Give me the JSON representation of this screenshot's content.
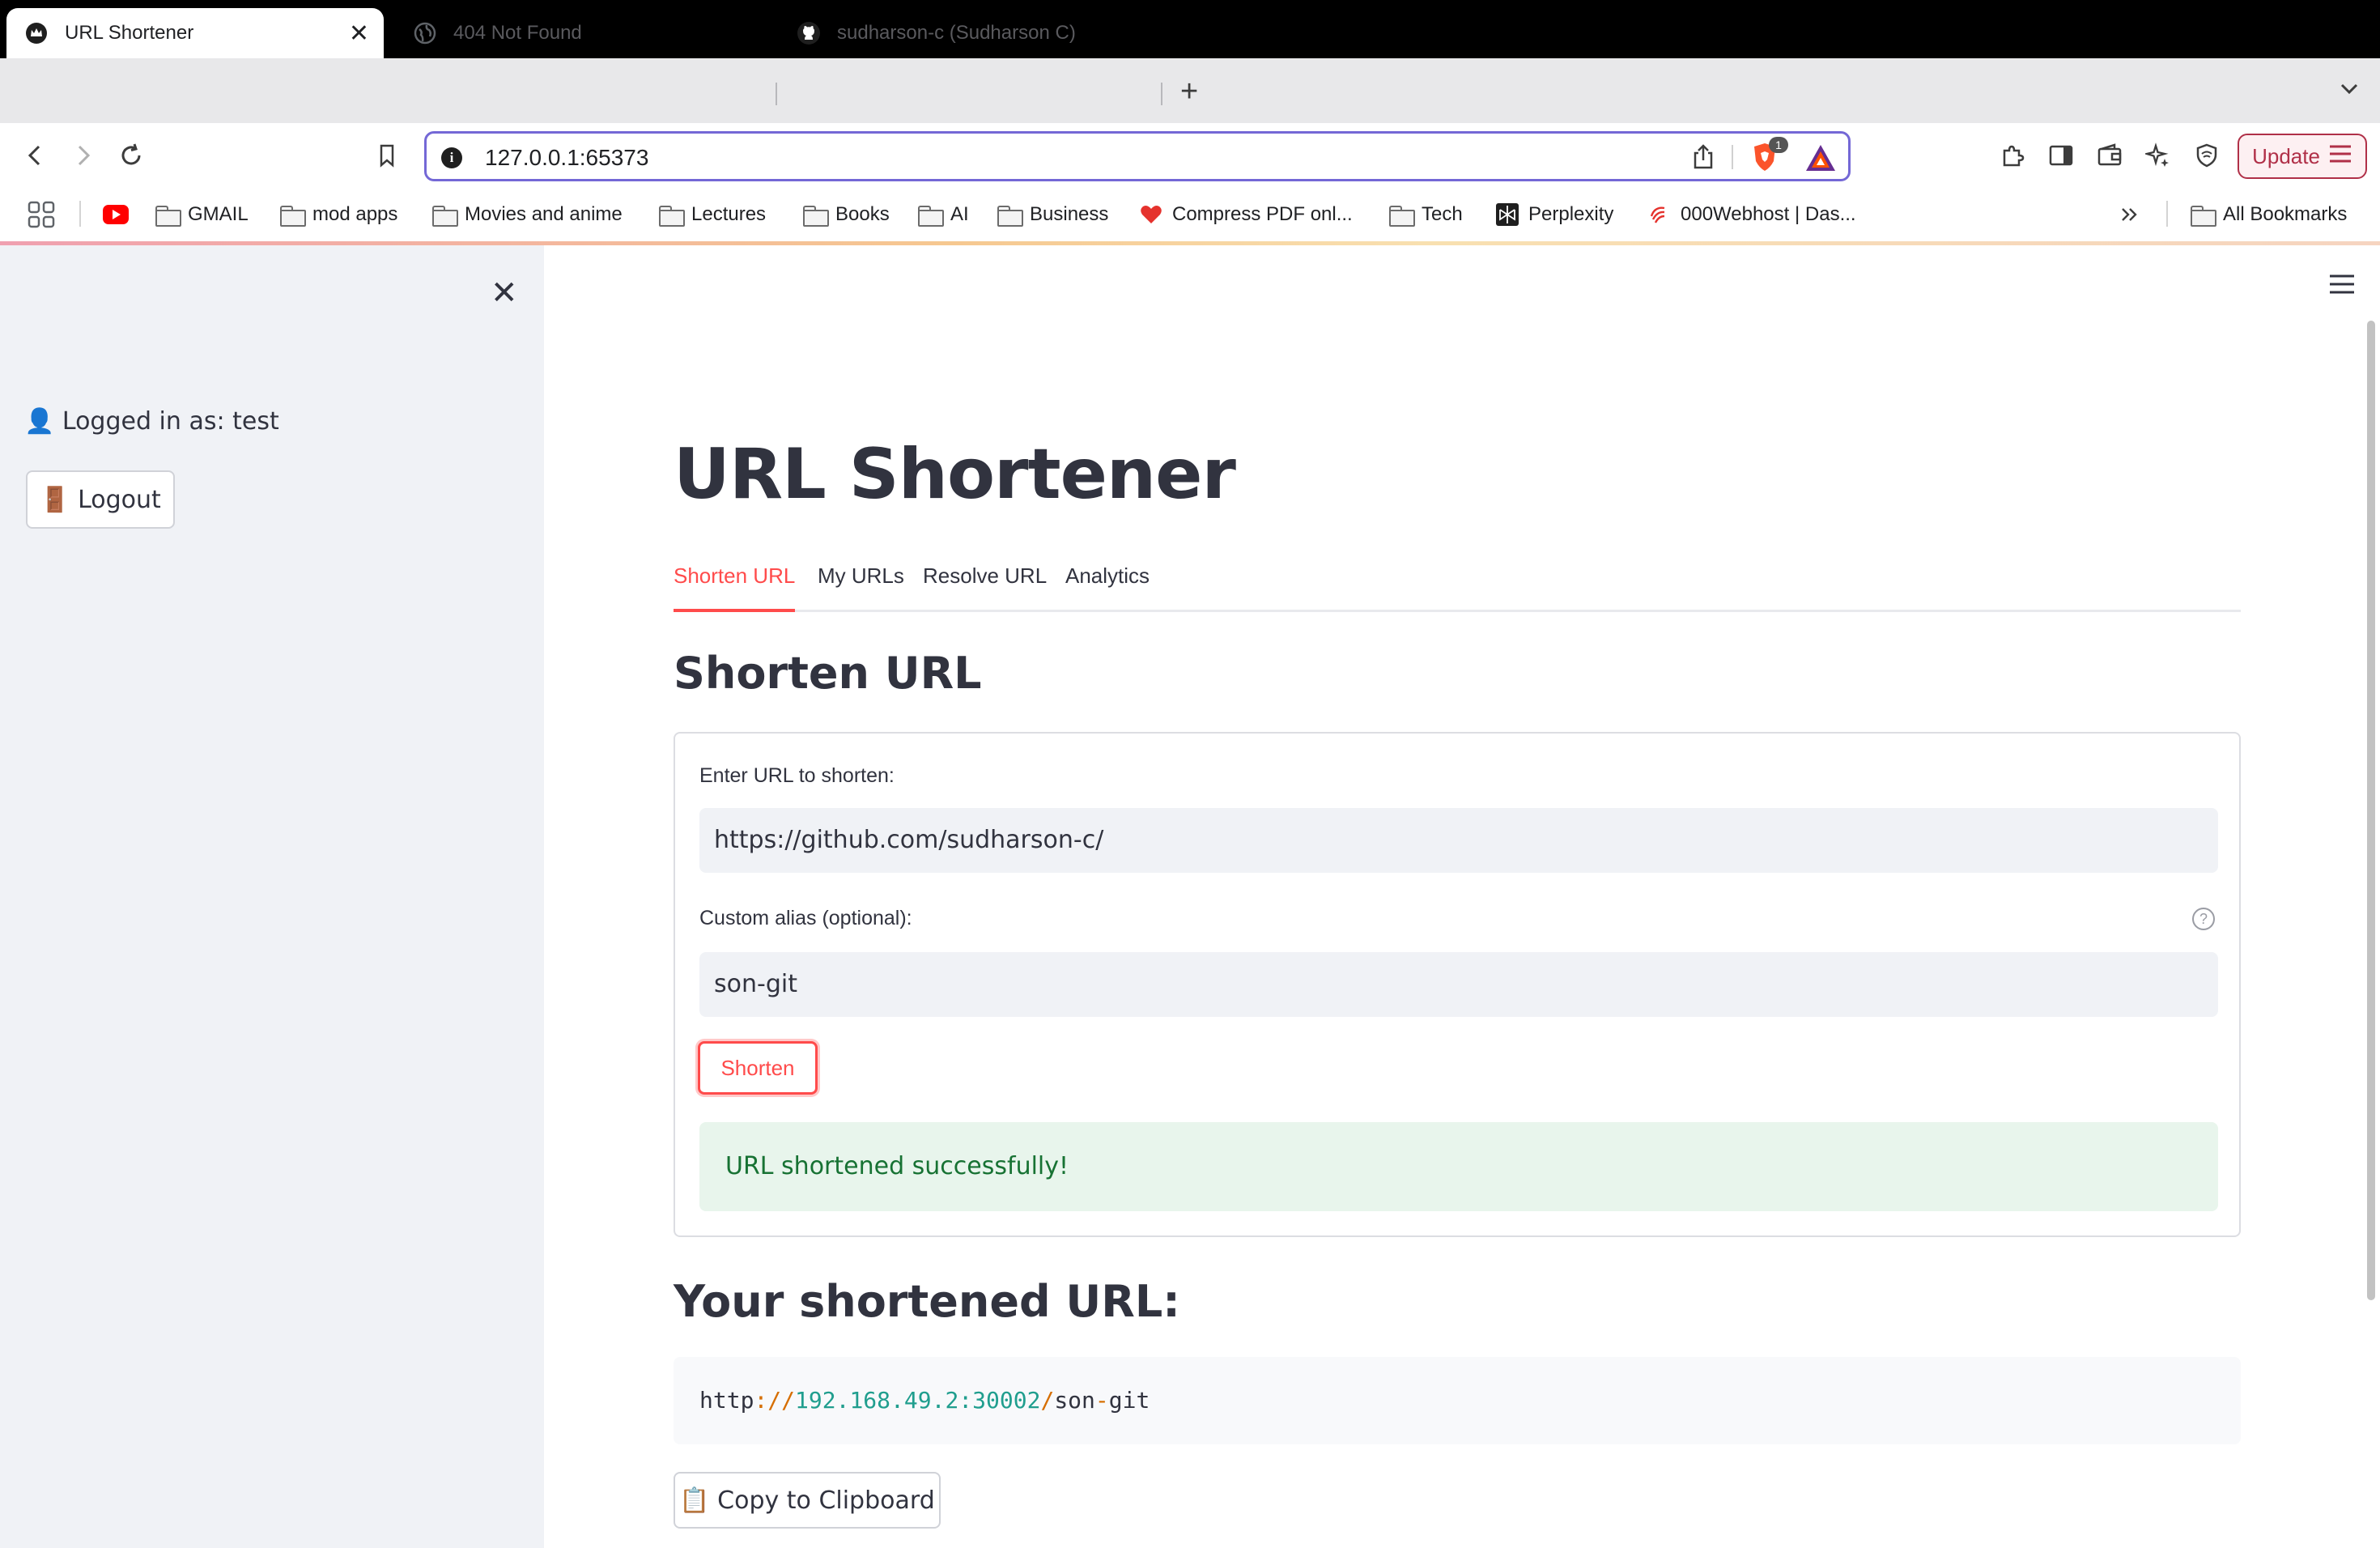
{
  "browser": {
    "tabs": [
      {
        "title": "URL Shortener",
        "icon": "streamlit-crown-icon",
        "active": true
      },
      {
        "title": "404 Not Found",
        "icon": "globe-icon",
        "active": false
      },
      {
        "title": "sudharson-c (Sudharson C)",
        "icon": "github-icon",
        "active": false
      }
    ],
    "address": "127.0.0.1:65373",
    "extension_badge": "1",
    "update_label": "Update"
  },
  "bookmarks": {
    "items": [
      {
        "label": "GMAIL",
        "icon": "folder-icon"
      },
      {
        "label": "mod apps",
        "icon": "folder-icon"
      },
      {
        "label": "Movies and anime",
        "icon": "folder-icon"
      },
      {
        "label": "Lectures",
        "icon": "folder-icon"
      },
      {
        "label": "Books",
        "icon": "folder-icon"
      },
      {
        "label": "AI",
        "icon": "folder-icon"
      },
      {
        "label": "Business",
        "icon": "folder-icon"
      },
      {
        "label": "Compress PDF onl...",
        "icon": "heart-pdf-icon"
      },
      {
        "label": "Tech",
        "icon": "folder-icon"
      },
      {
        "label": "Perplexity",
        "icon": "perplexity-icon"
      },
      {
        "label": "000Webhost | Das...",
        "icon": "webhost-icon"
      }
    ],
    "all_bookmarks": "All Bookmarks"
  },
  "sidebar": {
    "user_text": "👤 Logged in as: test",
    "logout_label": "🚪 Logout"
  },
  "main": {
    "title": "URL Shortener",
    "tabs": [
      "Shorten URL",
      "My URLs",
      "Resolve URL",
      "Analytics"
    ],
    "active_tab": 0,
    "section_heading": "Shorten URL",
    "url_label": "Enter URL to shorten:",
    "url_value": "https://github.com/sudharson-c/",
    "alias_label": "Custom alias (optional):",
    "alias_value": "son-git",
    "help_glyph": "?",
    "shorten_label": "Shorten",
    "success_message": "URL shortened successfully!",
    "result_heading": "Your shortened URL:",
    "short_url": {
      "scheme": "http",
      "sep1": ":",
      "slashes": "//",
      "host": "192.168.49.2:30002",
      "slash": "/",
      "path_a": "son",
      "dash": "-",
      "path_b": "git"
    },
    "copy_label": "📋 Copy to Clipboard"
  },
  "colors": {
    "accent": "#ff4b4b",
    "success_bg": "#e8f5ec",
    "success_text": "#177233",
    "sidebar_bg": "#f0f2f6",
    "omnibox_border": "#7468d6"
  }
}
